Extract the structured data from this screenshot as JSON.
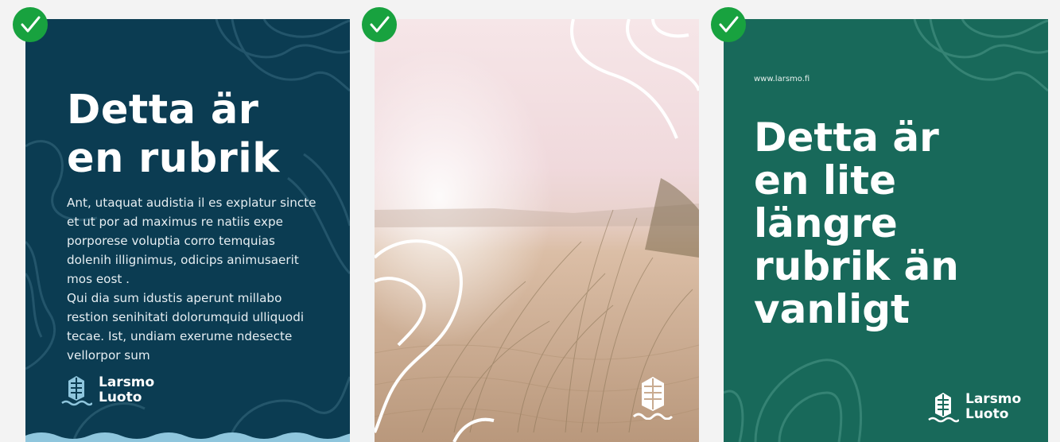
{
  "cards": [
    {
      "heading": "Detta är en rubrik",
      "paragraphs": [
        "Ant, utaquat audistia il es explatur sincte et ut por ad maximus re natiis expe porporese voluptia corro temquias dolenih illignimus, odicips animusaerit mos eost .",
        "Qui dia sum idustis aperunt millabo restion senihitati dolorumquid ulliquodi tecae. Ist, undiam exerume ndesecte vellorpor sum"
      ],
      "logo": {
        "line1": "Larsmo",
        "line2": "Luoto"
      },
      "background_color": "#0b3c52",
      "approved": true
    },
    {
      "image": "beach-dune-photo",
      "approved": true
    },
    {
      "url": "www.larsmo.fi",
      "heading": "Detta är en lite längre rubrik än vanligt",
      "logo": {
        "line1": "Larsmo",
        "line2": "Luoto"
      },
      "background_color": "#18695a",
      "approved": true
    }
  ],
  "colors": {
    "check": "#18a23f",
    "wave": "#8fc6dd"
  },
  "icons": [
    "check-icon",
    "larsmo-ship-logo-icon"
  ]
}
